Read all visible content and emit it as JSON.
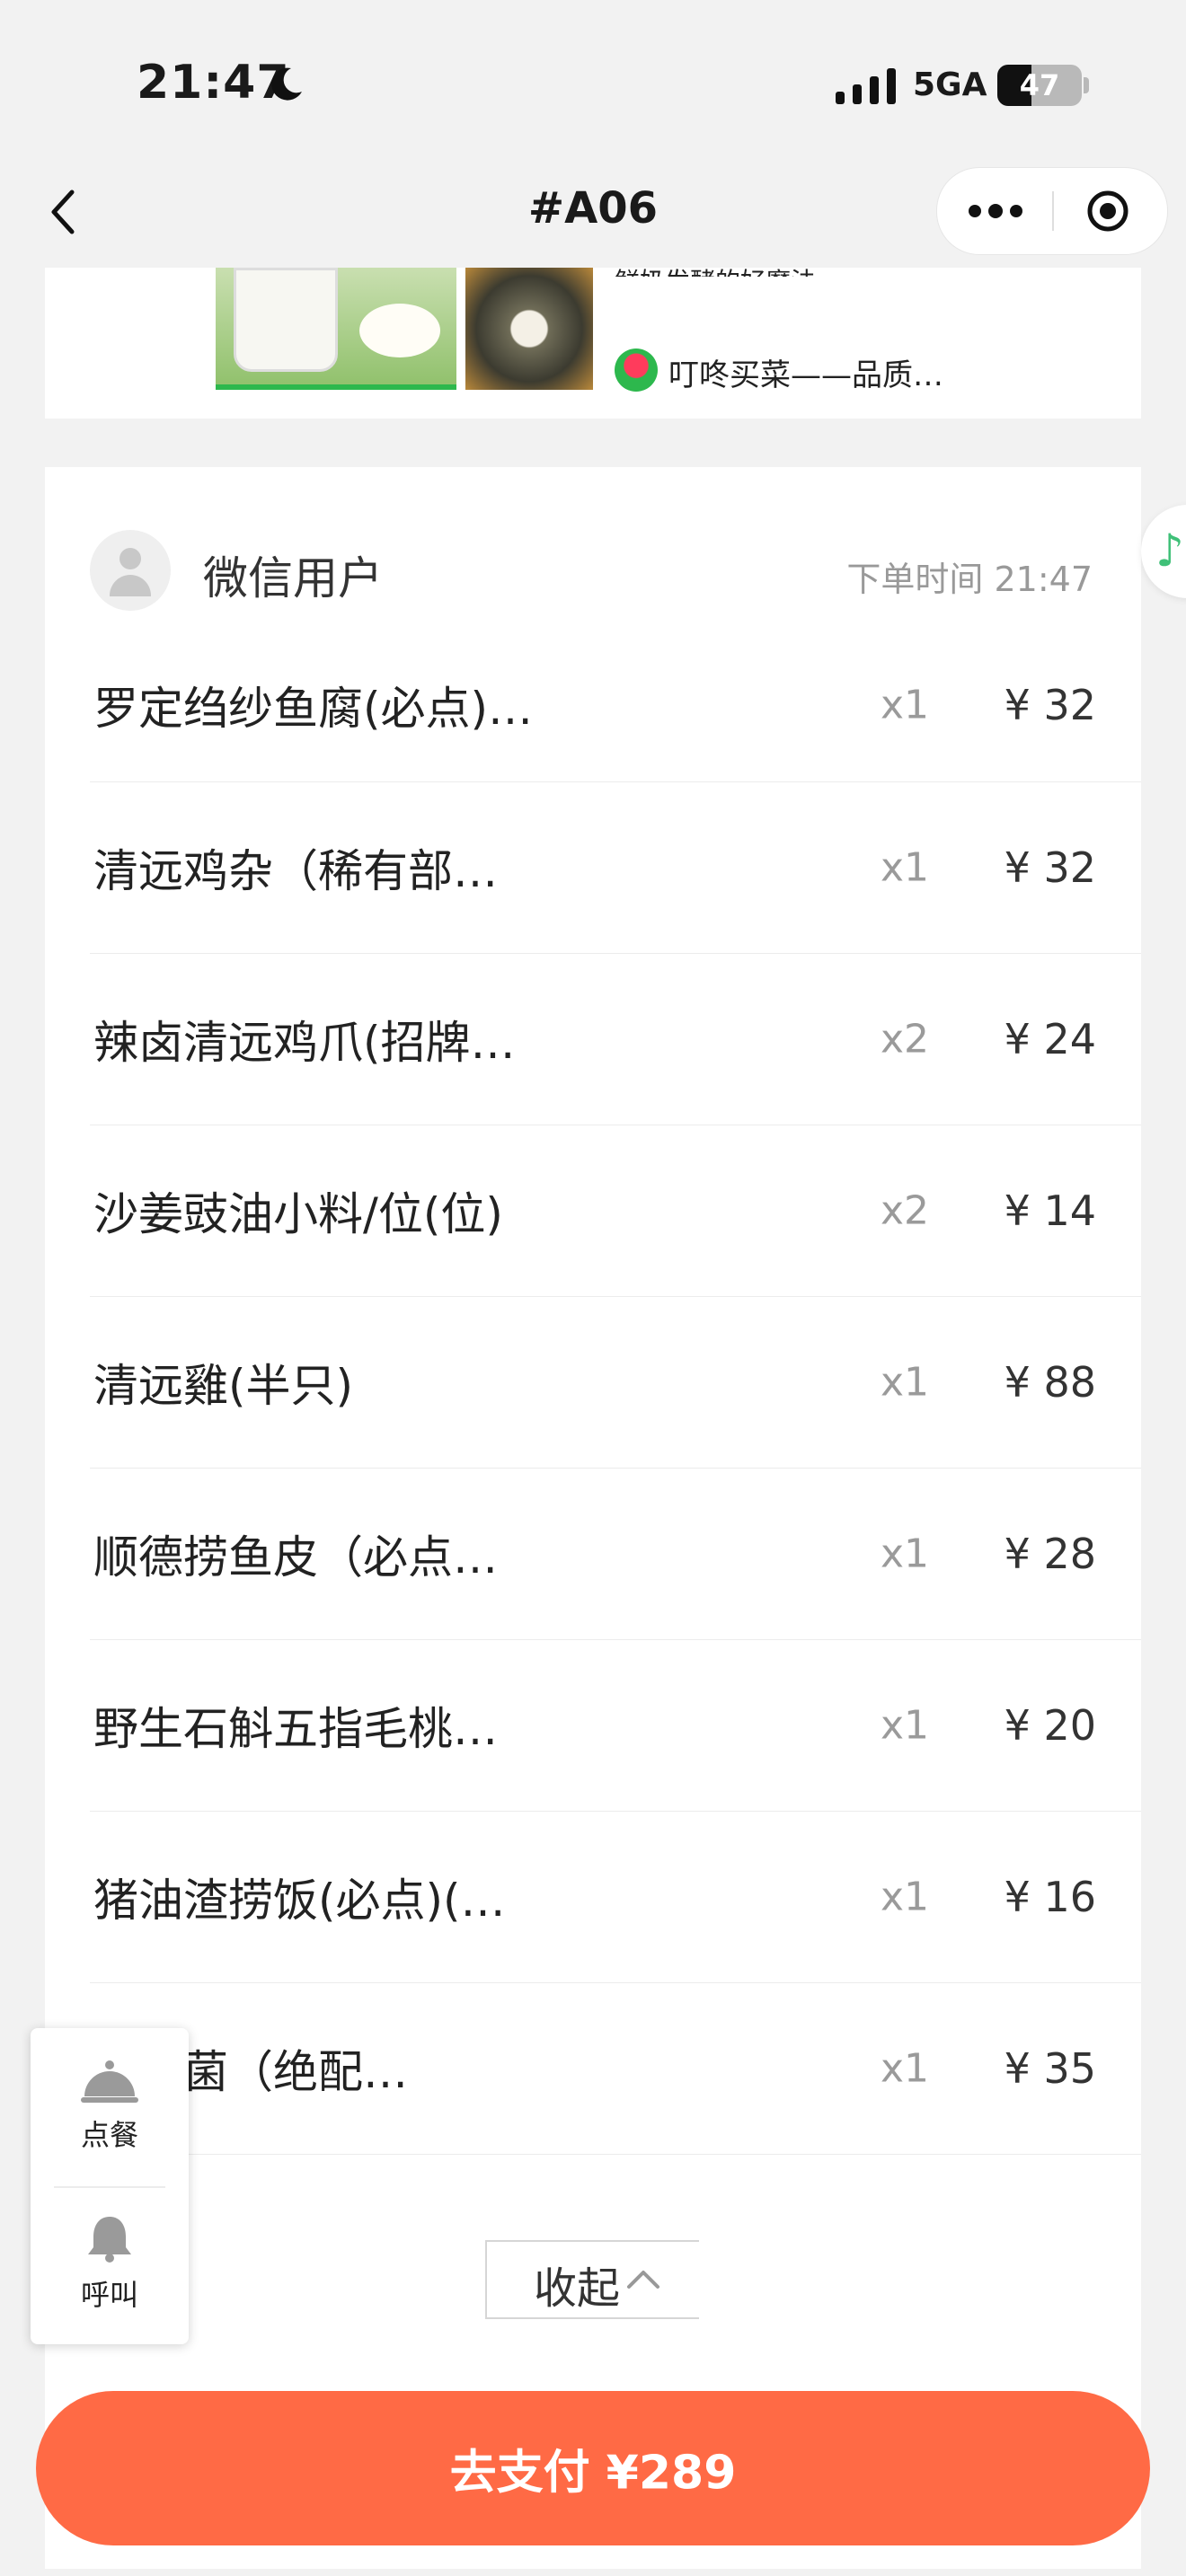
{
  "status_bar": {
    "time": "21:47",
    "network": "5GA",
    "battery": "47"
  },
  "nav": {
    "title": "#A06"
  },
  "ad": {
    "partial_text": "鲜奶发酵的好魔法",
    "brand_text": "叮咚买菜——品质…"
  },
  "order": {
    "user_name": "微信用户",
    "time_label": "下单时间",
    "time_value": "21:47",
    "items": [
      {
        "name": "罗定绉纱鱼腐(必点)…",
        "qty": "x1",
        "price": "¥ 32"
      },
      {
        "name": "清远鸡杂（稀有部…",
        "qty": "x1",
        "price": "¥ 32"
      },
      {
        "name": "辣卤清远鸡爪(招牌…",
        "qty": "x2",
        "price": "¥ 24"
      },
      {
        "name": "沙姜豉油小料/位(位)",
        "qty": "x2",
        "price": "¥ 14"
      },
      {
        "name": "清远雞(半只)",
        "qty": "x1",
        "price": "¥ 88"
      },
      {
        "name": "顺德捞鱼皮（必点…",
        "qty": "x1",
        "price": "¥ 28"
      },
      {
        "name": "野生石斛五指毛桃…",
        "qty": "x1",
        "price": "¥ 20"
      },
      {
        "name": "猪油渣捞饭(必点)(…",
        "qty": "x1",
        "price": "¥ 16"
      },
      {
        "name": "牛肝菌（绝配…",
        "qty": "x1",
        "price": "¥ 35"
      }
    ],
    "collapse_label": "收起"
  },
  "side_panel": {
    "order_label": "点餐",
    "call_label": "呼叫"
  },
  "pay": {
    "label": "去支付 ¥289"
  },
  "colors": {
    "accent": "#ff6a45",
    "music": "#3fc078"
  },
  "icons": [
    "back-icon",
    "more-dots-icon",
    "target-icon",
    "music-note-icon",
    "service-bell-icon",
    "bell-icon",
    "chevron-up-icon",
    "moon-icon",
    "signal-icon",
    "battery-icon"
  ]
}
